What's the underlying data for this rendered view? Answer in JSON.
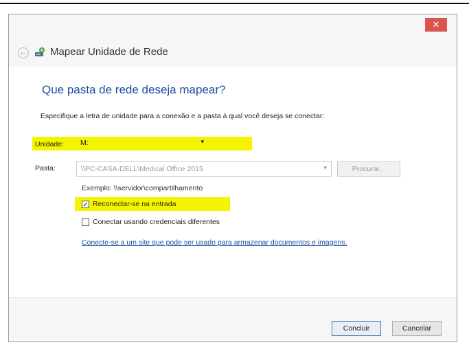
{
  "window": {
    "title": "Mapear Unidade de Rede",
    "close_glyph": "✕"
  },
  "nav": {
    "back_glyph": "←"
  },
  "content": {
    "heading": "Que pasta de rede deseja mapear?",
    "instruction": "Especifique a letra de unidade para a conexão e a pasta à qual você deseja se conectar:",
    "drive_label": "Unidade:",
    "drive_value": "M:",
    "folder_label": "Pasta:",
    "folder_value": "\\\\PC-CASA-DELL\\Medical Office 2015",
    "browse_label": "Procurar...",
    "example": "Exemplo: \\\\servidor\\compartilhamento",
    "reconnect_label": "Reconectar-se na entrada",
    "reconnect_checked": true,
    "credentials_label": "Conectar usando credenciais diferentes",
    "credentials_checked": false,
    "link_text": "Conecte-se a um site que pode ser usado para armazenar documentos e imagens."
  },
  "footer": {
    "finish_label": "Concluir",
    "cancel_label": "Cancelar"
  },
  "colors": {
    "highlight": "#f4f400",
    "heading": "#1f4e9e",
    "close_button": "#d9534f"
  },
  "icons": {
    "dropdown": "chevron-down-icon",
    "check": "checkmark-icon",
    "wizard": "network-drive-icon"
  }
}
